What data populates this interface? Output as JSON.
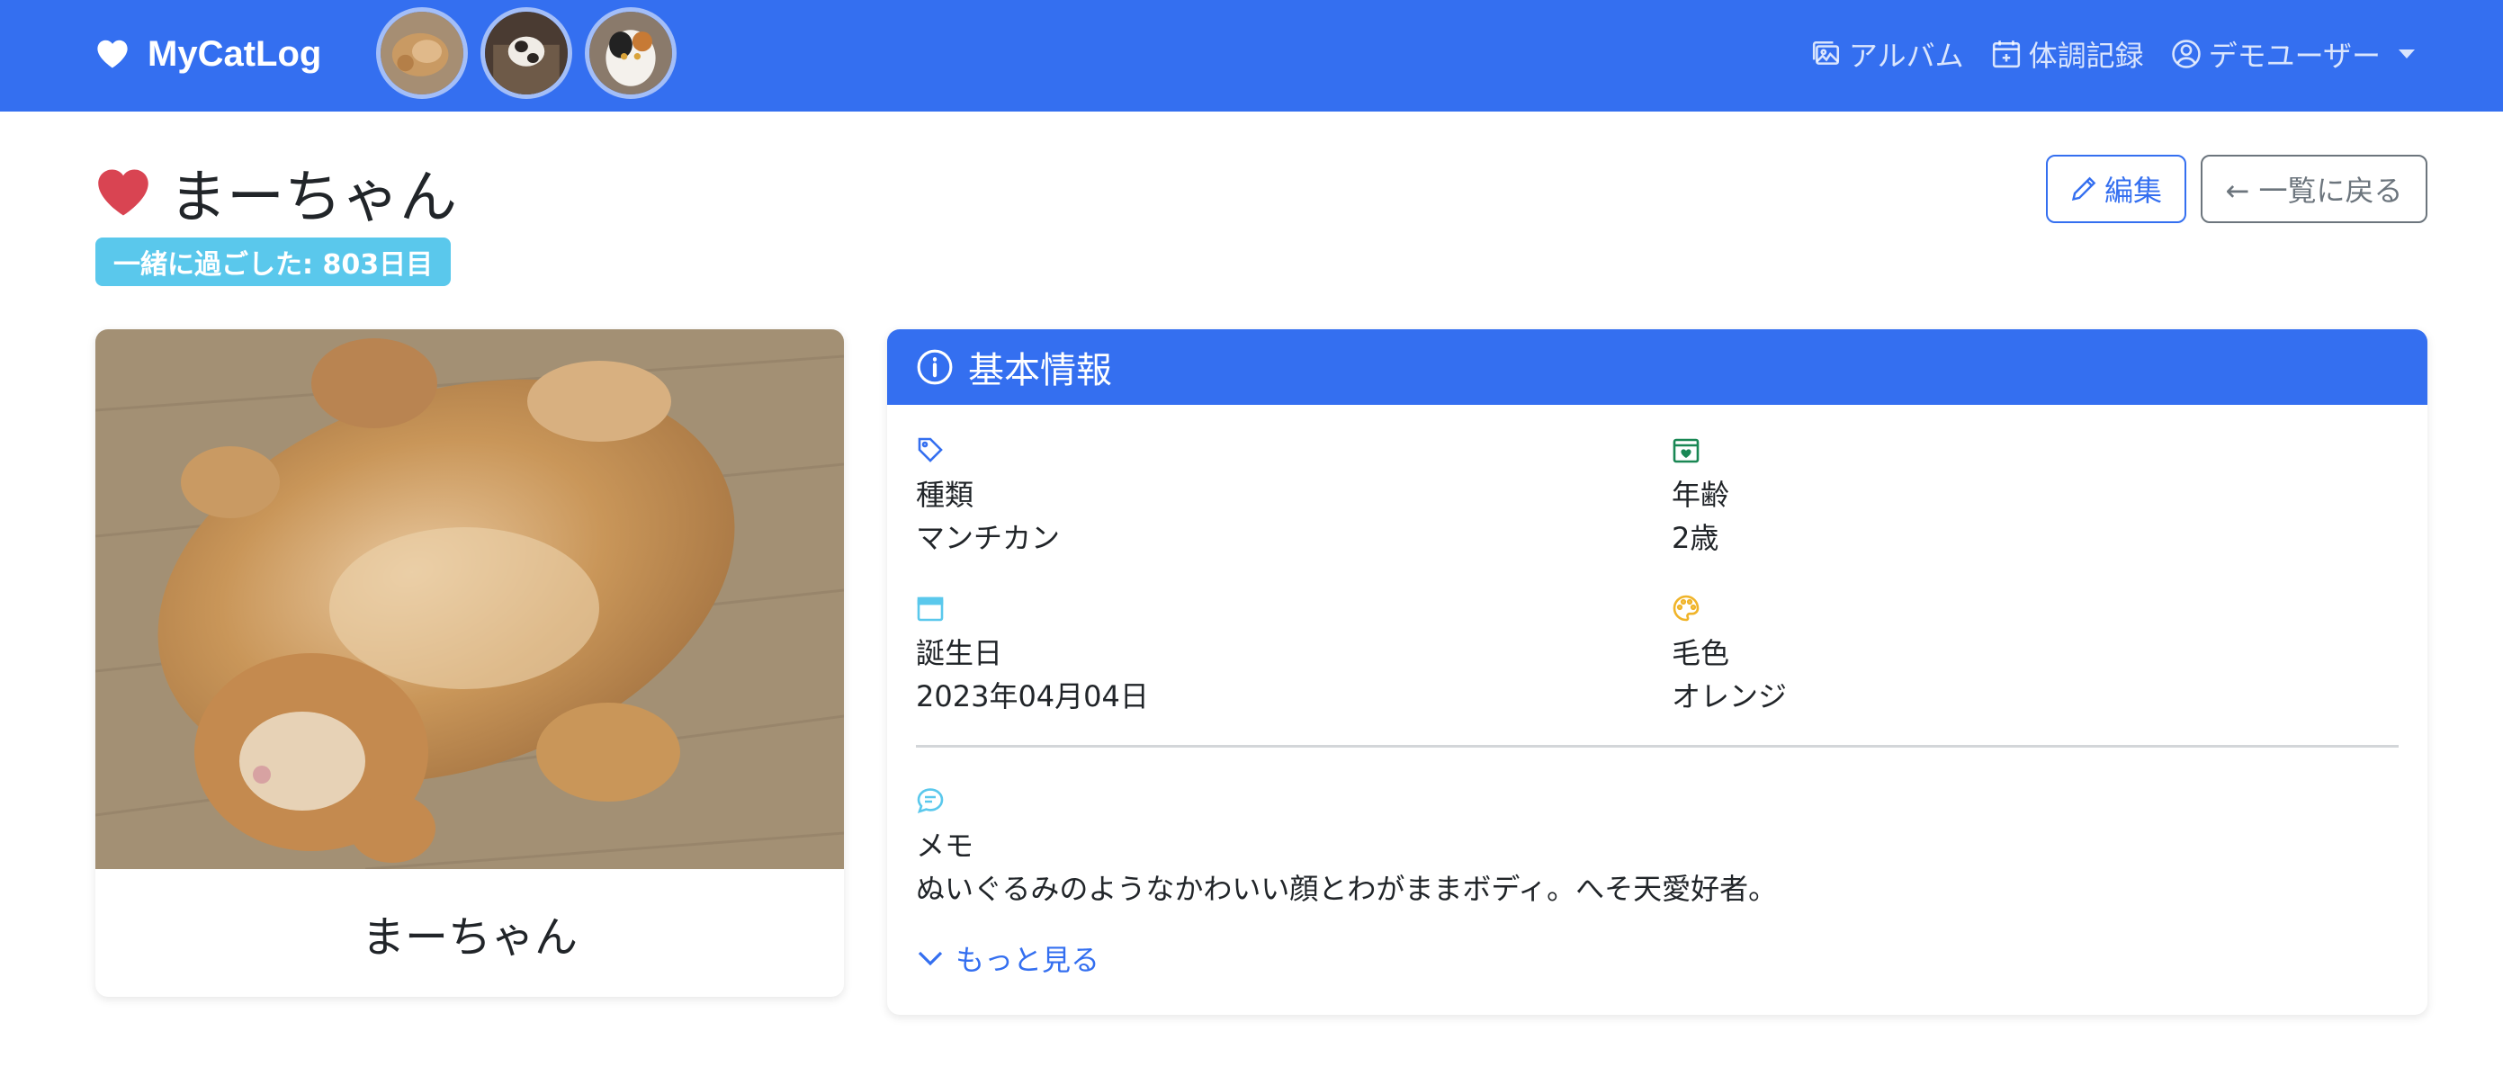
{
  "navbar": {
    "brand": "MyCatLog",
    "brand_icon": "heart-icon",
    "cat_thumbnails": [
      "cat-1",
      "cat-2",
      "cat-3"
    ],
    "links": [
      {
        "label": "アルバム",
        "icon": "images-icon"
      },
      {
        "label": "体調記録",
        "icon": "calendar-plus-icon"
      }
    ],
    "user": {
      "label": "デモユーザー",
      "icon": "person-circle-icon"
    },
    "bg_color": "#346ff0"
  },
  "header": {
    "title": "まーちゃん",
    "heart_color": "#dc3545",
    "days_badge": "一緒に過ごした: 803日目",
    "badge_color": "#5ac8ec",
    "edit_label": "編集",
    "back_label": "← 一覧に戻る"
  },
  "photo_card": {
    "caption": "まーちゃん"
  },
  "info": {
    "header": "基本情報",
    "fields": {
      "breed": {
        "label": "種類",
        "value": "マンチカン",
        "icon": "tag-icon"
      },
      "age": {
        "label": "年齢",
        "value": "2歳",
        "icon": "calendar-heart-icon"
      },
      "birthday": {
        "label": "誕生日",
        "value": "2023年04月04日",
        "icon": "calendar-icon"
      },
      "color": {
        "label": "毛色",
        "value": "オレンジ",
        "icon": "palette-icon"
      },
      "memo": {
        "label": "メモ",
        "value": "ぬいぐるみのようなかわいい顔とわがままボディ。へそ天愛好者。",
        "icon": "chat-text-icon"
      }
    },
    "more_label": "もっと見る"
  }
}
